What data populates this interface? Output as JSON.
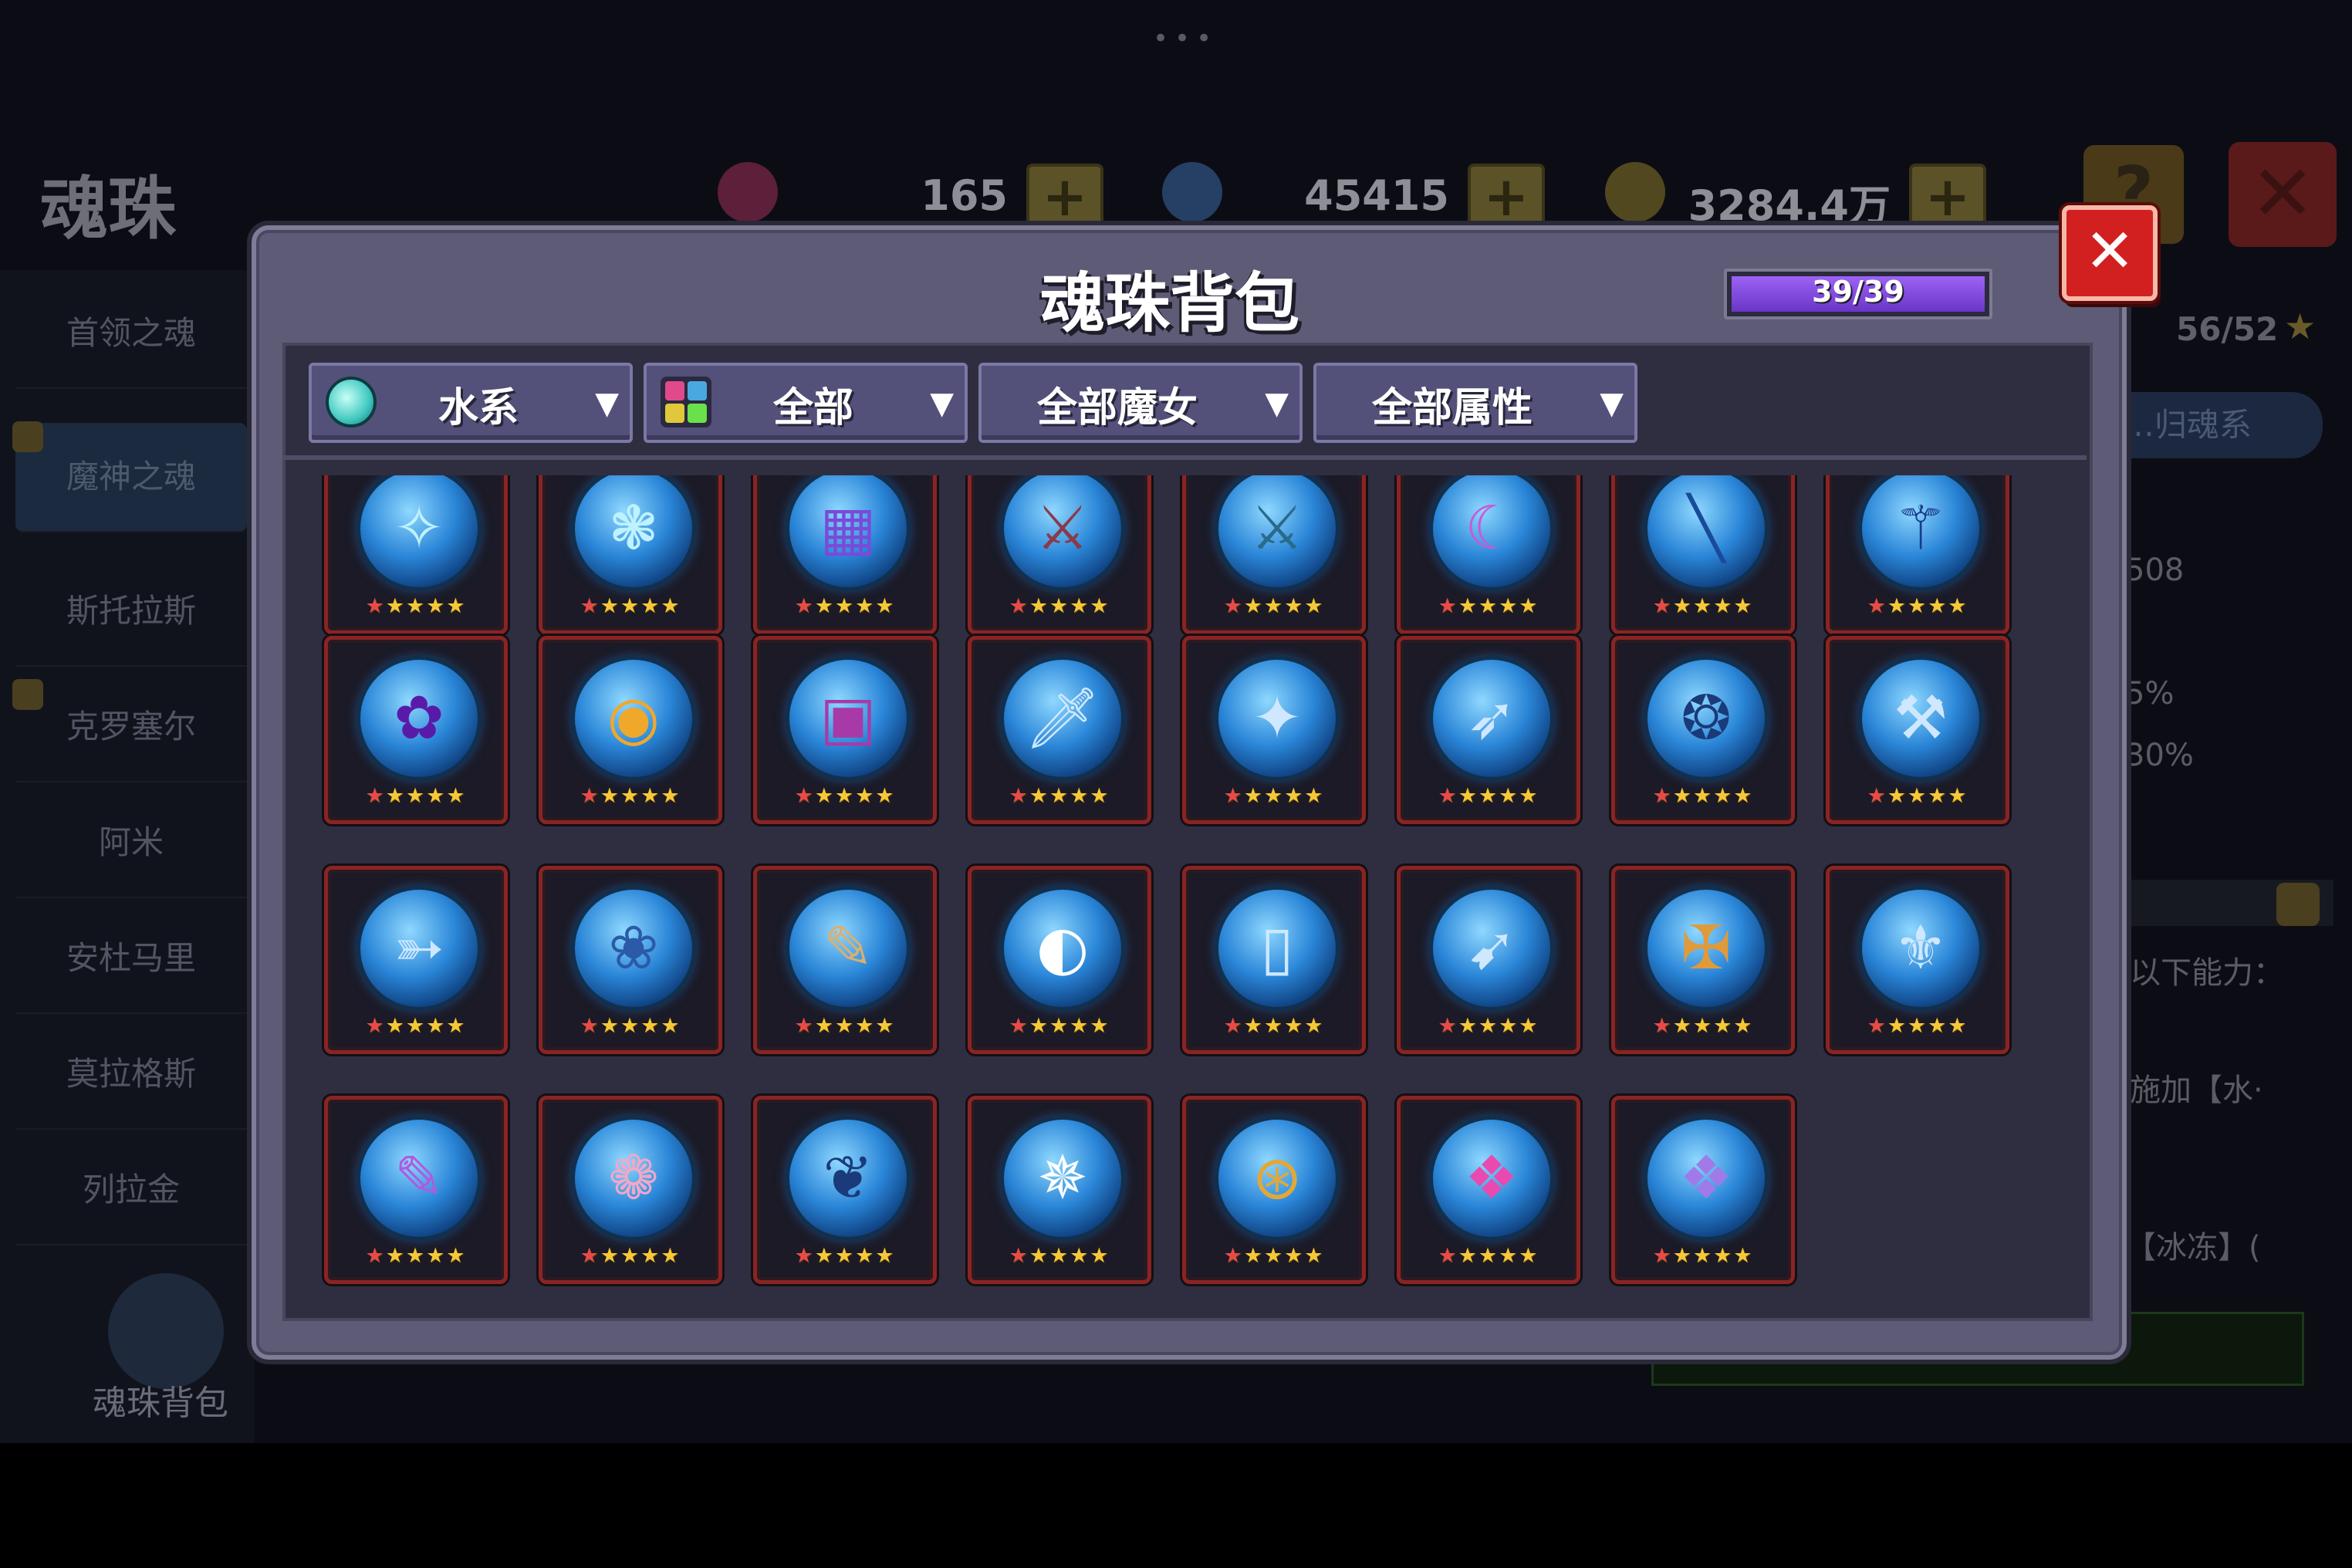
{
  "background": {
    "page_title": "魂珠",
    "resources": [
      {
        "value": "165",
        "gem_color": "#a0305a",
        "plus": "+"
      },
      {
        "value": "45415",
        "gem_color": "#3a6aa8",
        "plus": "+"
      },
      {
        "value": "3284.4万",
        "gem_color": "#8a7a2a",
        "plus": "+"
      }
    ],
    "help_label": "?",
    "close_label": "✕",
    "sidebar": [
      {
        "label": "首领之魂"
      },
      {
        "label": "魔神之魂",
        "active": true
      },
      {
        "label": "斯托拉斯"
      },
      {
        "label": "克罗塞尔"
      },
      {
        "label": "阿米"
      },
      {
        "label": "安杜马里"
      },
      {
        "label": "莫拉格斯"
      },
      {
        "label": "列拉金"
      }
    ],
    "bag_label": "魂珠背包",
    "right_panel": {
      "count": "56/52",
      "tab_label": "…归魂系",
      "lines": [
        "508",
        "5%",
        "30%",
        "以下能力：",
        "施加【水·",
        "【冰冻】("
      ]
    }
  },
  "modal": {
    "title": "魂珠背包",
    "capacity": "39/39",
    "capacity_fraction": 1.0,
    "close_label": "✕",
    "filters": [
      {
        "label": "水系",
        "icon": "water-element-icon"
      },
      {
        "label": "全部",
        "icon": "all-category-icon"
      },
      {
        "label": "全部魔女",
        "icon": ""
      },
      {
        "label": "全部属性",
        "icon": ""
      }
    ],
    "items": [
      {
        "glyph": "✧",
        "tint": "#bff2ff"
      },
      {
        "glyph": "❃",
        "tint": "#bff2ff"
      },
      {
        "glyph": "▦",
        "tint": "#7a4ad8"
      },
      {
        "glyph": "⚔",
        "tint": "#8a3a4a"
      },
      {
        "glyph": "⚔",
        "tint": "#2a6a8a"
      },
      {
        "glyph": "☾",
        "tint": "#c85ad8"
      },
      {
        "glyph": "╲",
        "tint": "#1a4a9a"
      },
      {
        "glyph": "⚚",
        "tint": "#1a3a8a"
      },
      {
        "glyph": "✿",
        "tint": "#5a1aa8"
      },
      {
        "glyph": "◉",
        "tint": "#f0a82a"
      },
      {
        "glyph": "▣",
        "tint": "#a83aa8"
      },
      {
        "glyph": "🗡",
        "tint": "#cfe8ff"
      },
      {
        "glyph": "✦",
        "tint": "#cfe8ff"
      },
      {
        "glyph": "➶",
        "tint": "#cfe8ff"
      },
      {
        "glyph": "❂",
        "tint": "#1a3a7a"
      },
      {
        "glyph": "⚒",
        "tint": "#cfe8ff"
      },
      {
        "glyph": "➳",
        "tint": "#cfe8ff"
      },
      {
        "glyph": "❀",
        "tint": "#2a5aa8"
      },
      {
        "glyph": "✎",
        "tint": "#d8b070"
      },
      {
        "glyph": "◐",
        "tint": "#ffffff"
      },
      {
        "glyph": "▯",
        "tint": "#cfe8ff"
      },
      {
        "glyph": "➹",
        "tint": "#cfe8ff"
      },
      {
        "glyph": "✠",
        "tint": "#e09a3a"
      },
      {
        "glyph": "⚜",
        "tint": "#cfe8ff"
      },
      {
        "glyph": "✎",
        "tint": "#b05ae0"
      },
      {
        "glyph": "❁",
        "tint": "#f0a8c8"
      },
      {
        "glyph": "❦",
        "tint": "#1a3a7a"
      },
      {
        "glyph": "✵",
        "tint": "#ffffff"
      },
      {
        "glyph": "⊛",
        "tint": "#e0a83a"
      },
      {
        "glyph": "❖",
        "tint": "#e84ab0"
      },
      {
        "glyph": "❖",
        "tint": "#a07ae8"
      }
    ],
    "stars_per_item": 5
  }
}
